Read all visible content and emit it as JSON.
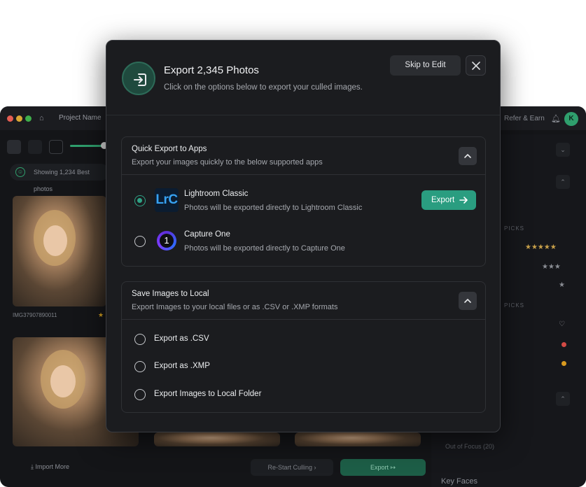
{
  "background_app": {
    "project_name": "Project Name",
    "refer_label": "Refer & Earn",
    "avatar_letter": "K",
    "showing_label": "Showing 1,234 Best photos",
    "photo_caption": "IMG37907890011",
    "import_label": "Import More",
    "restart_label": "Re-Start Culling",
    "export_label": "Export",
    "out_of_focus": "Out of Focus (20)",
    "key_faces": "Key Faces",
    "picks_label": "PICKS"
  },
  "modal": {
    "title": "Export 2,345 Photos",
    "subtitle": "Click on the options below to export your culled images.",
    "skip_label": "Skip to Edit",
    "quick_export": {
      "title": "Quick Export to Apps",
      "description": "Export your images quickly to the below supported apps",
      "apps": [
        {
          "name": "Lightroom Classic",
          "logo_text": "LrC",
          "description": "Photos will be exported directly to Lightroom Classic",
          "selected": true
        },
        {
          "name": "Capture One",
          "logo_text": "1",
          "description": "Photos will be exported directly to Capture One",
          "selected": false
        }
      ],
      "export_button": "Export"
    },
    "save_local": {
      "title": "Save Images to Local",
      "description": "Export Images to your local files or as .CSV or .XMP formats",
      "options": [
        "Export as .CSV",
        "Export as .XMP",
        "Export Images to Local Folder"
      ]
    }
  },
  "colors": {
    "accent": "#2a9d80",
    "modal_bg": "#1b1c1f",
    "lightroom_blue": "#37a2f2"
  }
}
